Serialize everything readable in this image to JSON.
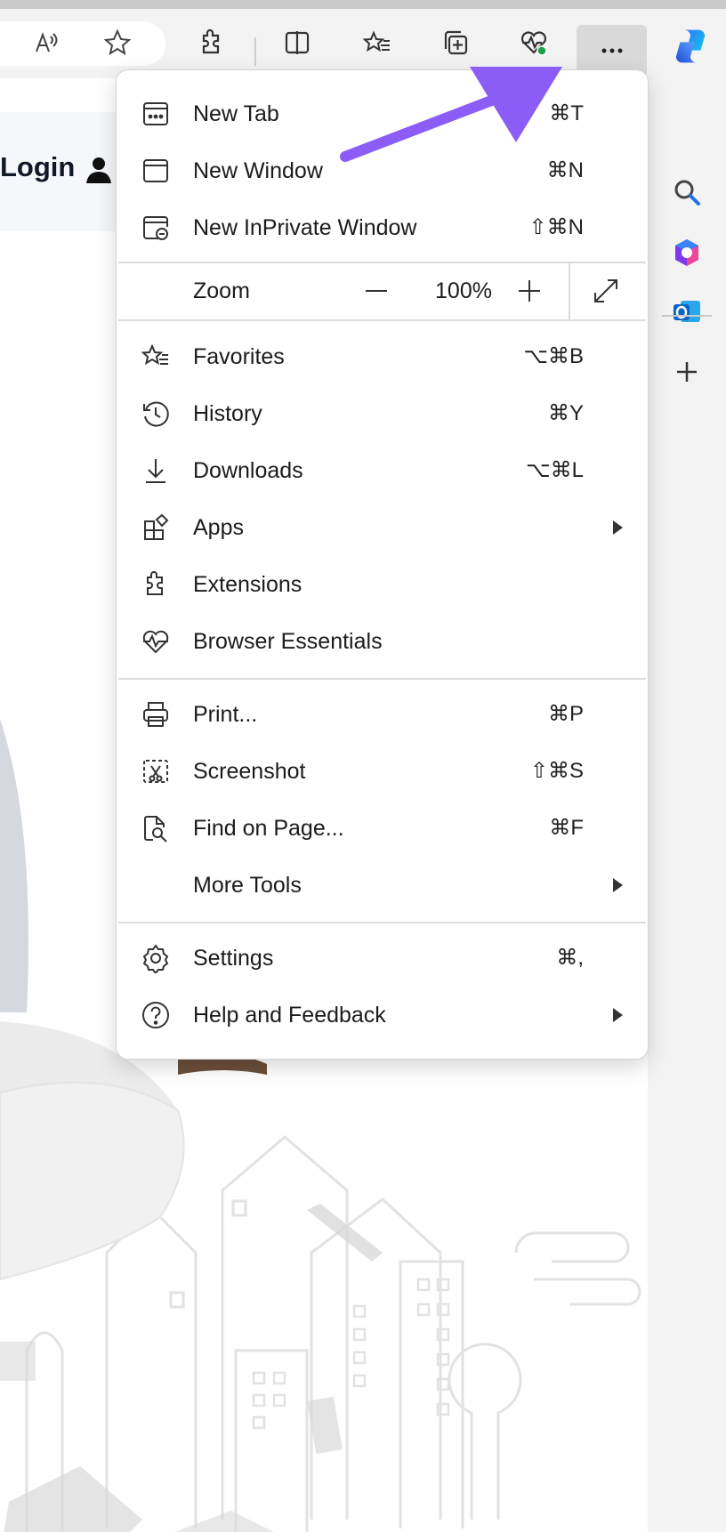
{
  "page": {
    "login_label": "Login"
  },
  "menu": {
    "items": [
      {
        "label": "New Tab",
        "shortcut": "⌘T",
        "icon": "new-tab-icon"
      },
      {
        "label": "New Window",
        "shortcut": "⌘N",
        "icon": "new-window-icon"
      },
      {
        "label": "New InPrivate Window",
        "shortcut": "⇧⌘N",
        "icon": "inprivate-icon"
      },
      {
        "label": "Favorites",
        "shortcut": "⌥⌘B",
        "icon": "favorites-icon"
      },
      {
        "label": "History",
        "shortcut": "⌘Y",
        "icon": "history-icon"
      },
      {
        "label": "Downloads",
        "shortcut": "⌥⌘L",
        "icon": "download-icon"
      },
      {
        "label": "Apps",
        "shortcut": "",
        "icon": "apps-icon"
      },
      {
        "label": "Extensions",
        "shortcut": "",
        "icon": "extensions-icon"
      },
      {
        "label": "Browser Essentials",
        "shortcut": "",
        "icon": "browser-essentials-icon"
      },
      {
        "label": "Print...",
        "shortcut": "⌘P",
        "icon": "print-icon"
      },
      {
        "label": "Screenshot",
        "shortcut": "⇧⌘S",
        "icon": "screenshot-icon"
      },
      {
        "label": "Find on Page...",
        "shortcut": "⌘F",
        "icon": "find-icon"
      },
      {
        "label": "More Tools",
        "shortcut": "",
        "icon": ""
      },
      {
        "label": "Settings",
        "shortcut": "⌘,",
        "icon": "settings-icon"
      },
      {
        "label": "Help and Feedback",
        "shortcut": "",
        "icon": "help-icon"
      }
    ],
    "zoom": {
      "label": "Zoom",
      "value": "100%"
    }
  },
  "colors": {
    "arrow": "#8b5cf6",
    "toolbar_bg": "#f3f3f3",
    "menu_bg": "#ffffff",
    "health_badge": "#16a34a"
  }
}
